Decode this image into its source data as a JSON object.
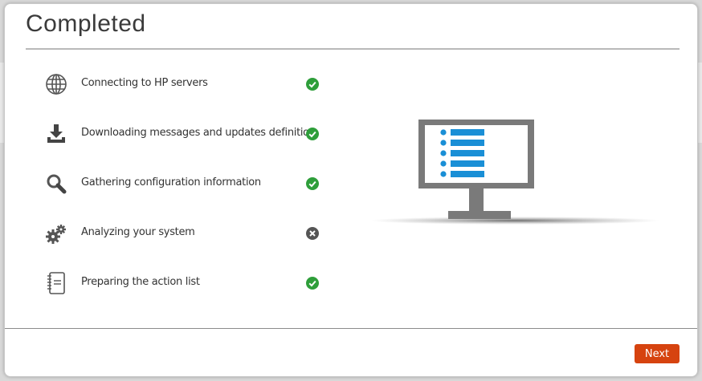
{
  "dialog": {
    "title": "Completed"
  },
  "steps": [
    {
      "label": "Connecting to HP servers",
      "icon": "globe-icon",
      "status": "success"
    },
    {
      "label": "Downloading messages and updates definition",
      "icon": "download-icon",
      "status": "success"
    },
    {
      "label": "Gathering configuration information",
      "icon": "magnifier-icon",
      "status": "success"
    },
    {
      "label": "Analyzing your system",
      "icon": "gears-icon",
      "status": "failed"
    },
    {
      "label": "Preparing the action list",
      "icon": "notepad-icon",
      "status": "success"
    }
  ],
  "illustration": {
    "icon": "monitor-list-icon"
  },
  "footer": {
    "next_label": "Next"
  },
  "colors": {
    "success": "#2e9e3a",
    "failed": "#555555",
    "accent": "#d6430f",
    "list_blue": "#1a8fd6"
  }
}
